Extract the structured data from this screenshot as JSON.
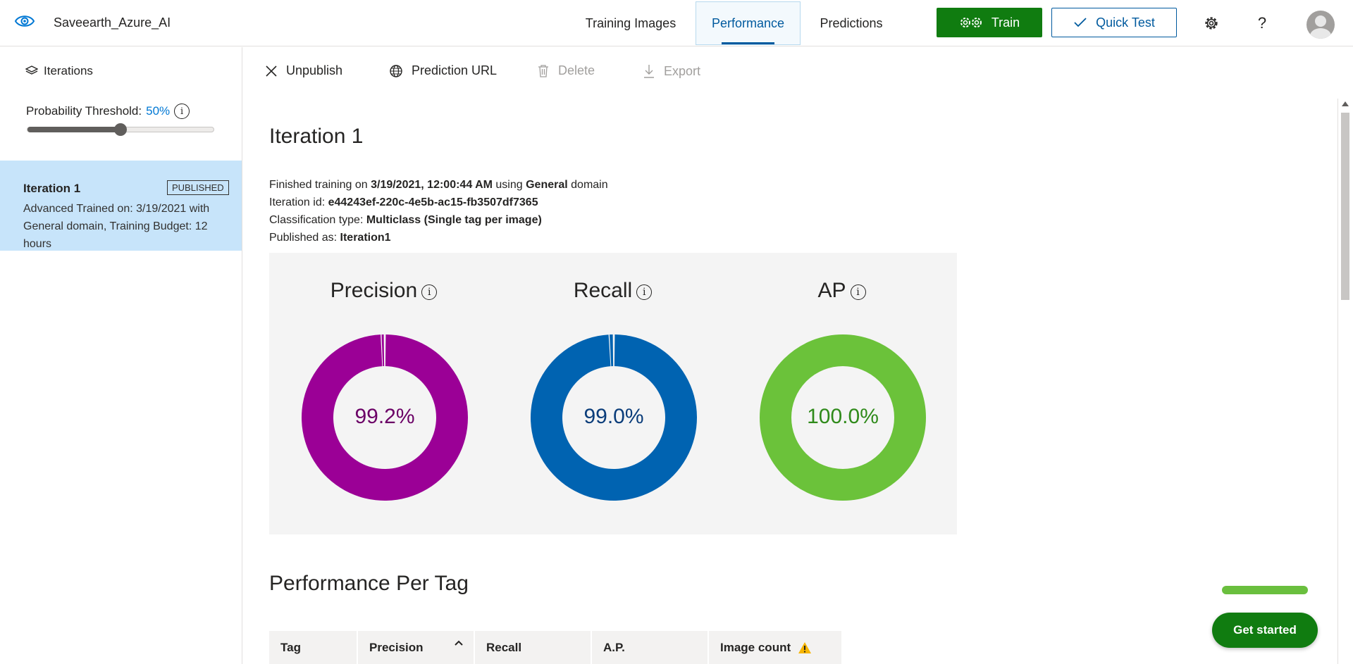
{
  "app": {
    "project_name": "Saveearth_Azure_AI"
  },
  "nav": {
    "tabs": [
      {
        "label": "Training Images"
      },
      {
        "label": "Performance"
      },
      {
        "label": "Predictions"
      }
    ],
    "train_label": "Train",
    "quick_test_label": "Quick Test",
    "help_label": "?"
  },
  "sidebar": {
    "header": "Iterations",
    "threshold_label": "Probability Threshold:",
    "threshold_value": "50%",
    "threshold_level": 0.5,
    "iteration": {
      "name": "Iteration 1",
      "badge": "PUBLISHED",
      "description": "Advanced Trained on: 3/19/2021 with General domain, Training Budget: 12 hours"
    }
  },
  "toolbar": {
    "unpublish": "Unpublish",
    "prediction_url": "Prediction URL",
    "delete": "Delete",
    "export": "Export"
  },
  "main": {
    "title": "Iteration 1",
    "finished_prefix": "Finished training on",
    "finished_date": "3/19/2021, 12:00:44 AM",
    "using": "using",
    "domain_name": "General",
    "domain_suffix": "domain",
    "iteration_id_label": "Iteration id:",
    "iteration_id": "e44243ef-220c-4e5b-ac15-fb3507df7365",
    "classification_label": "Classification type:",
    "classification_value": "Multiclass (Single tag per image)",
    "published_label": "Published as:",
    "published_value": "Iteration1",
    "metrics": [
      {
        "name": "Precision",
        "value_text": "99.2%",
        "value": 99.2,
        "color": "#9b0096",
        "text_color": "#6b0066"
      },
      {
        "name": "Recall",
        "value_text": "99.0%",
        "value": 99.0,
        "color": "#0063b1",
        "text_color": "#0b3d7a"
      },
      {
        "name": "AP",
        "value_text": "100.0%",
        "value": 100.0,
        "color": "#6bc23a",
        "text_color": "#2f8a1a"
      }
    ],
    "per_tag_title": "Performance Per Tag",
    "table_headers": [
      "Tag",
      "Precision",
      "Recall",
      "A.P.",
      "Image count"
    ]
  },
  "widgets": {
    "get_started": "Get started",
    "get_started_progress": 1.0
  }
}
